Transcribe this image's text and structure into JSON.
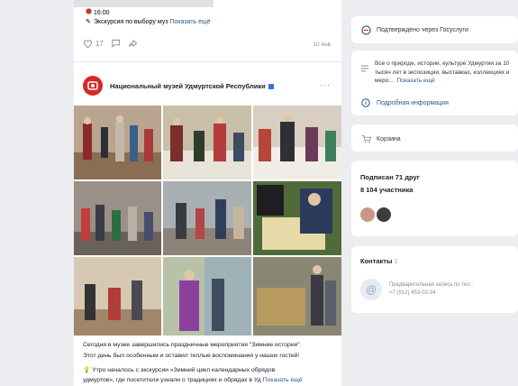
{
  "feed": {
    "prev_post": {
      "time": "16:00",
      "line_text": "Экскурсия по выбору муз",
      "show_more": "Показать ещё",
      "likes": "17",
      "date": "10 янв"
    },
    "post": {
      "author": "Национальный музей Удмуртской Республики",
      "line1": "Сегодня в музее завершились праздничные мероприятия \"Зимние истории\".",
      "line2": "Этот день был особенным и оставил теплые воспоминания у наших гостей!",
      "line3": "Утро началось с экскурсии «Зимний цикл календарных обрядов",
      "line4": "удмуртов», где посетители узнали о традициях и обрядах в Уд",
      "show_more": "Показать ещё"
    }
  },
  "sidebar": {
    "gosuslugi": "Подтверждено через Госуслуги",
    "about_text": "Все о природе, истории, культуре Удмуртии за 10 тысяч лет в экспозиции, выставках, коллекциях и меро...",
    "about_more": "Показать ещё",
    "details_link": "Подробная информация",
    "cart": "Корзина",
    "friends": "Подписан 71 друг",
    "members": "8 104 участника",
    "contacts_title": "Контакты",
    "contacts_count": "1",
    "contact_label": "Предварительная запись по тел.:",
    "contact_phone": "+7 (912) 453-03-34"
  },
  "colors": {
    "accent": "#2a5885",
    "museum_avatar": "#d42a2a",
    "background": "#ebedf0"
  }
}
